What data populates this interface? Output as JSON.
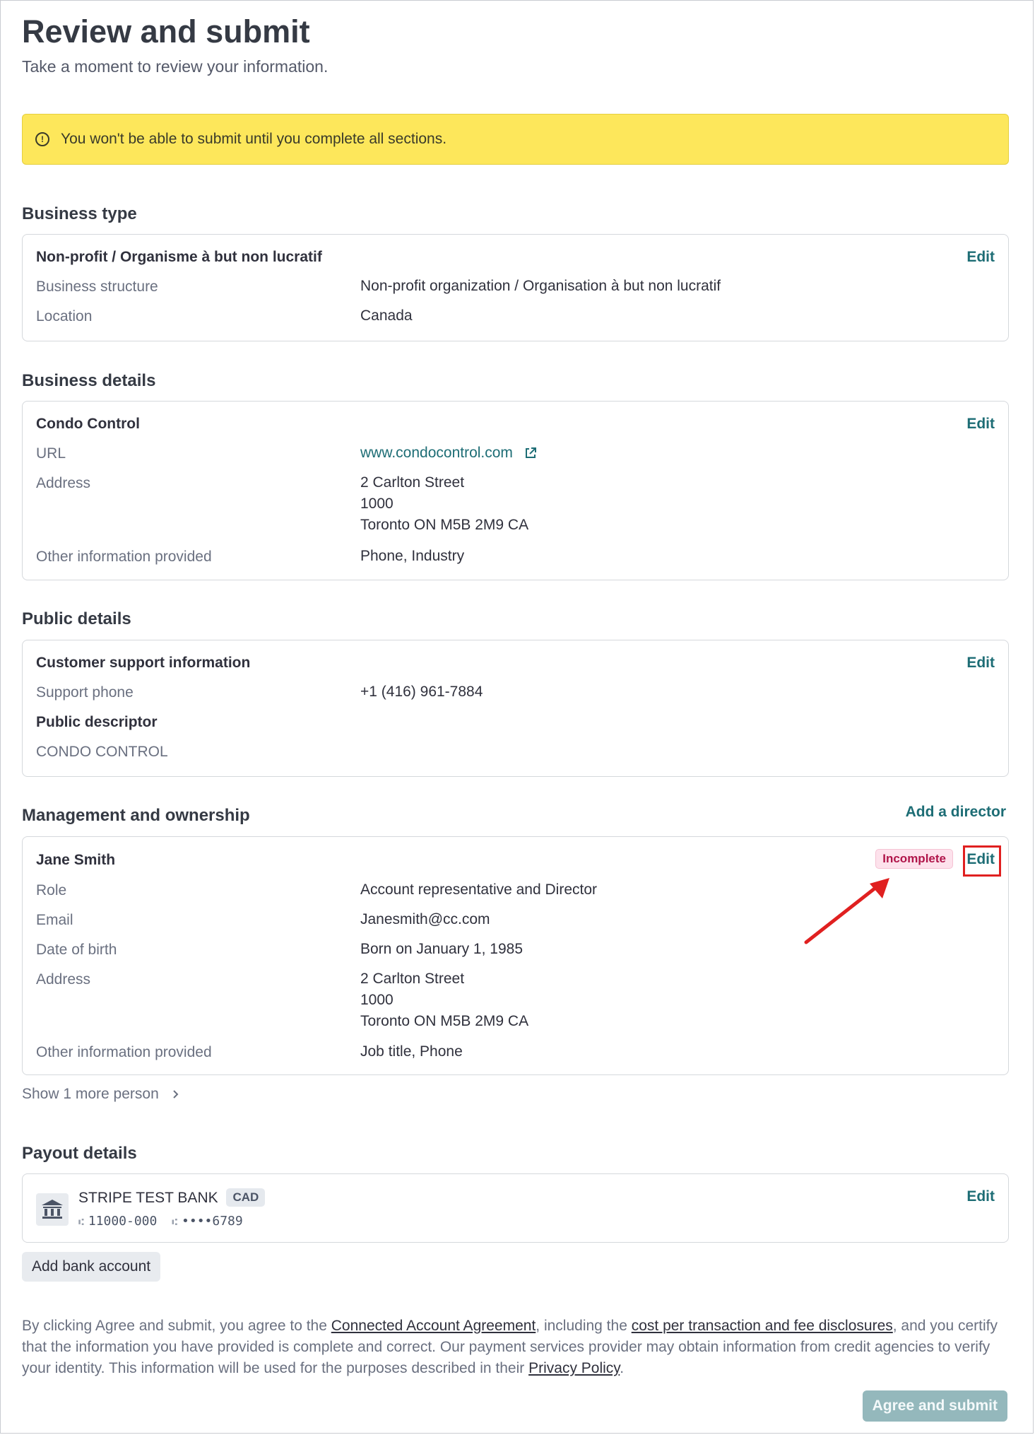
{
  "header": {
    "title": "Review and submit",
    "subtitle": "Take a moment to review your information."
  },
  "banner": {
    "text": "You won't be able to submit until you complete all sections.",
    "color": "#fde75b"
  },
  "edit_label": "Edit",
  "business_type": {
    "section_title": "Business type",
    "heading": "Non-profit / Organisme à but non lucratif",
    "rows": [
      {
        "label": "Business structure",
        "value": "Non-profit organization / Organisation à but non lucratif"
      },
      {
        "label": "Location",
        "value": "Canada"
      }
    ]
  },
  "business_details": {
    "section_title": "Business details",
    "heading": "Condo Control",
    "url_label": "URL",
    "url_value": "www.condocontrol.com",
    "address_label": "Address",
    "address_lines": [
      "2 Carlton Street",
      "1000",
      "Toronto ON M5B 2M9 CA"
    ],
    "other_label": "Other information provided",
    "other_value": "Phone, Industry"
  },
  "public_details": {
    "section_title": "Public details",
    "heading": "Customer support information",
    "support_phone_label": "Support phone",
    "support_phone_value": "+1 (416) 961-7884",
    "descriptor_heading": "Public descriptor",
    "descriptor_value": "CONDO CONTROL"
  },
  "management": {
    "section_title": "Management and ownership",
    "add_director_label": "Add a director",
    "person_name": "Jane Smith",
    "status_badge": "Incomplete",
    "role_label": "Role",
    "role_value": "Account representative and Director",
    "email_label": "Email",
    "email_value": "Janesmith@cc.com",
    "dob_label": "Date of birth",
    "dob_value": "Born on January 1, 1985",
    "address_label": "Address",
    "address_lines": [
      "2 Carlton Street",
      "1000",
      "Toronto ON M5B 2M9 CA"
    ],
    "other_label": "Other information provided",
    "other_value": "Job title, Phone",
    "show_more_label": "Show 1 more person"
  },
  "payout": {
    "section_title": "Payout details",
    "bank_name": "STRIPE TEST BANK",
    "currency": "CAD",
    "routing": "11000-000",
    "account": "••••6789",
    "add_bank_label": "Add bank account"
  },
  "legal": {
    "t1": "By clicking Agree and submit, you agree to the ",
    "link1": "Connected Account Agreement",
    "t2": ", including the ",
    "link2": "cost per transaction and fee disclosures",
    "t3": ", and you certify that the information you have provided is complete and correct. Our payment services provider may obtain information from credit agencies to verify your identity. This information will be used for the purposes described in their ",
    "link3": "Privacy Policy",
    "t4": "."
  },
  "submit_label": "Agree and submit",
  "colors": {
    "accent": "#1d6d75",
    "incomplete_badge": "#b0154a",
    "highlight": "#e02020"
  }
}
